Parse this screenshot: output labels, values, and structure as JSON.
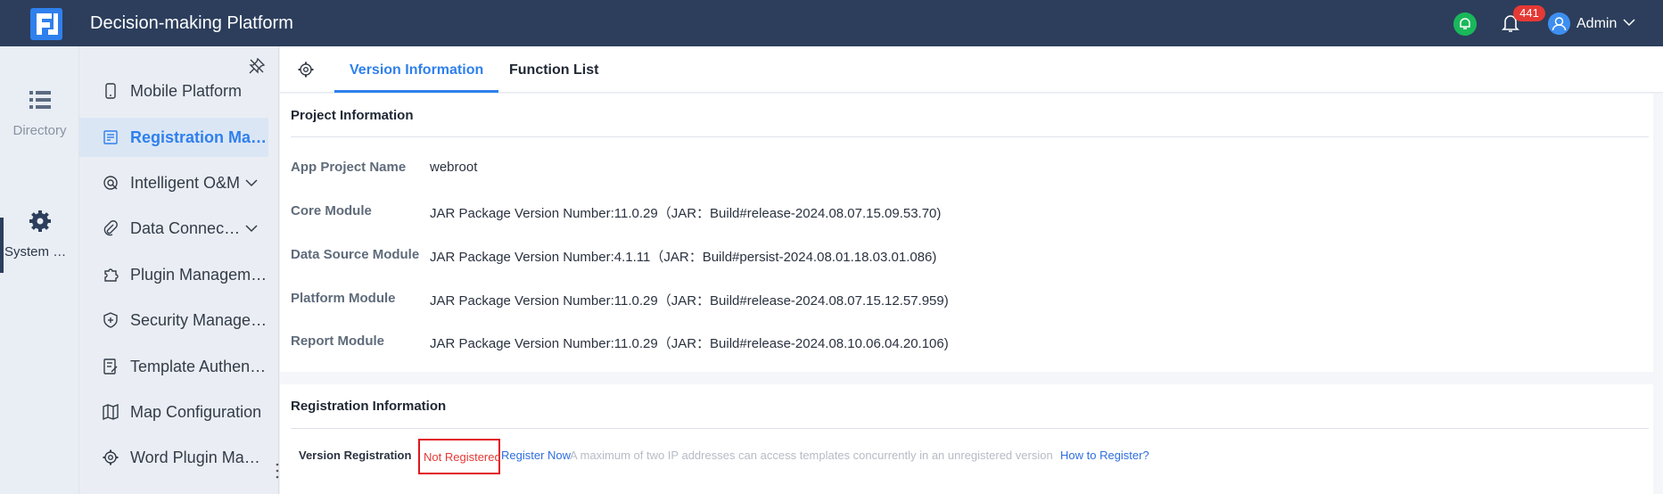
{
  "app": {
    "title": "Decision-making Platform",
    "notification_count": "441",
    "user_name": "Admin"
  },
  "rail": {
    "items": [
      {
        "label": "Directory",
        "icon": "list-icon"
      },
      {
        "label": "System Management",
        "icon": "gear-icon"
      }
    ]
  },
  "menu": {
    "items": [
      {
        "label": "Mobile Platform",
        "icon": "mobile-icon"
      },
      {
        "label": "Registration Management",
        "icon": "registration-icon",
        "active": true
      },
      {
        "label": "Intelligent O&M",
        "icon": "om-icon",
        "expandable": true
      },
      {
        "label": "Data Connection",
        "icon": "paperclip-icon",
        "expandable": true
      },
      {
        "label": "Plugin Management",
        "icon": "puzzle-icon"
      },
      {
        "label": "Security Management",
        "icon": "shield-icon"
      },
      {
        "label": "Template Authentication",
        "icon": "template-icon"
      },
      {
        "label": "Map Configuration",
        "icon": "map-icon"
      },
      {
        "label": "Word Plugin Management",
        "icon": "gear-icon"
      }
    ]
  },
  "tabs": {
    "items": [
      {
        "label": "Version Information",
        "active": true
      },
      {
        "label": "Function List",
        "active": false
      }
    ]
  },
  "project": {
    "title": "Project Information",
    "rows": [
      {
        "label": "App Project Name",
        "value": "webroot"
      },
      {
        "label": "Core Module",
        "value": "JAR Package Version Number:11.0.29（JAR：Build#release-2024.08.07.15.09.53.70)"
      },
      {
        "label": "Data Source Module",
        "value": "JAR Package Version Number:4.1.11（JAR：Build#persist-2024.08.01.18.03.01.086)"
      },
      {
        "label": "Platform Module",
        "value": "JAR Package Version Number:11.0.29（JAR：Build#release-2024.08.07.15.12.57.959)"
      },
      {
        "label": "Report Module",
        "value": "JAR Package Version Number:11.0.29（JAR：Build#release-2024.08.10.06.04.20.106)"
      }
    ]
  },
  "registration": {
    "title": "Registration Information",
    "label": "Version Registration",
    "status": "Not Registered",
    "register_link": "Register Now",
    "note": "A maximum of two IP addresses can access templates concurrently in an unregistered version",
    "help_link": "How to Register?"
  },
  "colors": {
    "header_bg": "#2c3e5c",
    "accent": "#2f80ed",
    "badge": "#e53935",
    "status_error": "#e0141e",
    "chat_green": "#19b85a"
  }
}
